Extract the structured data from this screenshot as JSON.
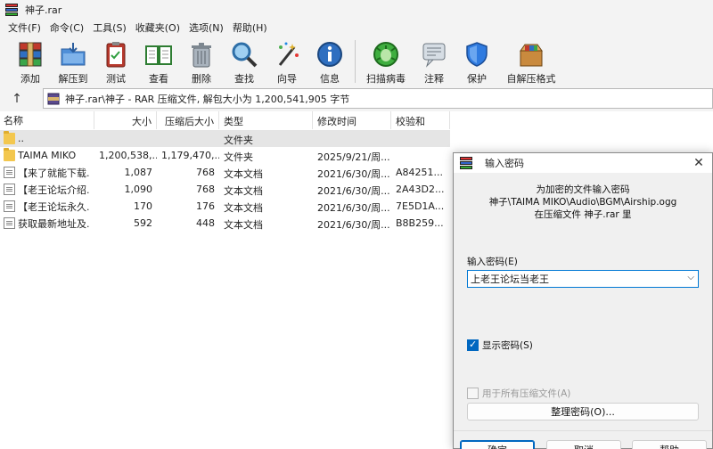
{
  "window": {
    "title": "神子.rar"
  },
  "menu": [
    "文件(F)",
    "命令(C)",
    "工具(S)",
    "收藏夹(O)",
    "选项(N)",
    "帮助(H)"
  ],
  "toolbar": {
    "add": "添加",
    "extract": "解压到",
    "test": "测试",
    "view": "查看",
    "delete": "删除",
    "find": "查找",
    "wizard": "向导",
    "info": "信息",
    "virus": "扫描病毒",
    "comment": "注释",
    "protect": "保护",
    "sfx": "自解压格式"
  },
  "address": {
    "path": "神子.rar\\神子 - RAR 压缩文件, 解包大小为 1,200,541,905 字节"
  },
  "columns": {
    "name": "名称",
    "size": "大小",
    "packed": "压缩后大小",
    "type": "类型",
    "modified": "修改时间",
    "crc": "校验和"
  },
  "files": [
    {
      "name": "..",
      "size": "",
      "packed": "",
      "type": "文件夹",
      "modified": "",
      "crc": "",
      "icon": "folder-icon"
    },
    {
      "name": "TAIMA MIKO",
      "size": "1,200,538,...",
      "packed": "1,179,470,...",
      "type": "文件夹",
      "modified": "2025/9/21/周...",
      "crc": "",
      "icon": "folder-icon"
    },
    {
      "name": "【来了就能下载...",
      "size": "1,087",
      "packed": "768",
      "type": "文本文档",
      "modified": "2021/6/30/周...",
      "crc": "A84251...",
      "icon": "document-icon"
    },
    {
      "name": "【老王论坛介绍...",
      "size": "1,090",
      "packed": "768",
      "type": "文本文档",
      "modified": "2021/6/30/周...",
      "crc": "2A43D2...",
      "icon": "document-icon"
    },
    {
      "name": "【老王论坛永久...",
      "size": "170",
      "packed": "176",
      "type": "文本文档",
      "modified": "2021/6/30/周...",
      "crc": "7E5D1A...",
      "icon": "document-icon"
    },
    {
      "name": "获取最新地址及...",
      "size": "592",
      "packed": "448",
      "type": "文本文档",
      "modified": "2021/6/30/周...",
      "crc": "B8B259...",
      "icon": "document-icon"
    }
  ],
  "dialog": {
    "title": "输入密码",
    "info_line1": "为加密的文件输入密码",
    "info_line2": "神子\\TAIMA MIKO\\Audio\\BGM\\Airship.ogg",
    "info_line3": "在压缩文件 神子.rar 里",
    "password_label": "输入密码(E)",
    "password_value": "上老王论坛当老王",
    "show_password": "显示密码(S)",
    "show_password_checked": true,
    "use_for_all": "用于所有压缩文件(A)",
    "use_for_all_checked": false,
    "organize": "整理密码(O)...",
    "ok": "确定",
    "cancel": "取消",
    "help": "帮助"
  },
  "colors": {
    "accent": "#0067c0",
    "selected_row": "#e5e5e5"
  }
}
